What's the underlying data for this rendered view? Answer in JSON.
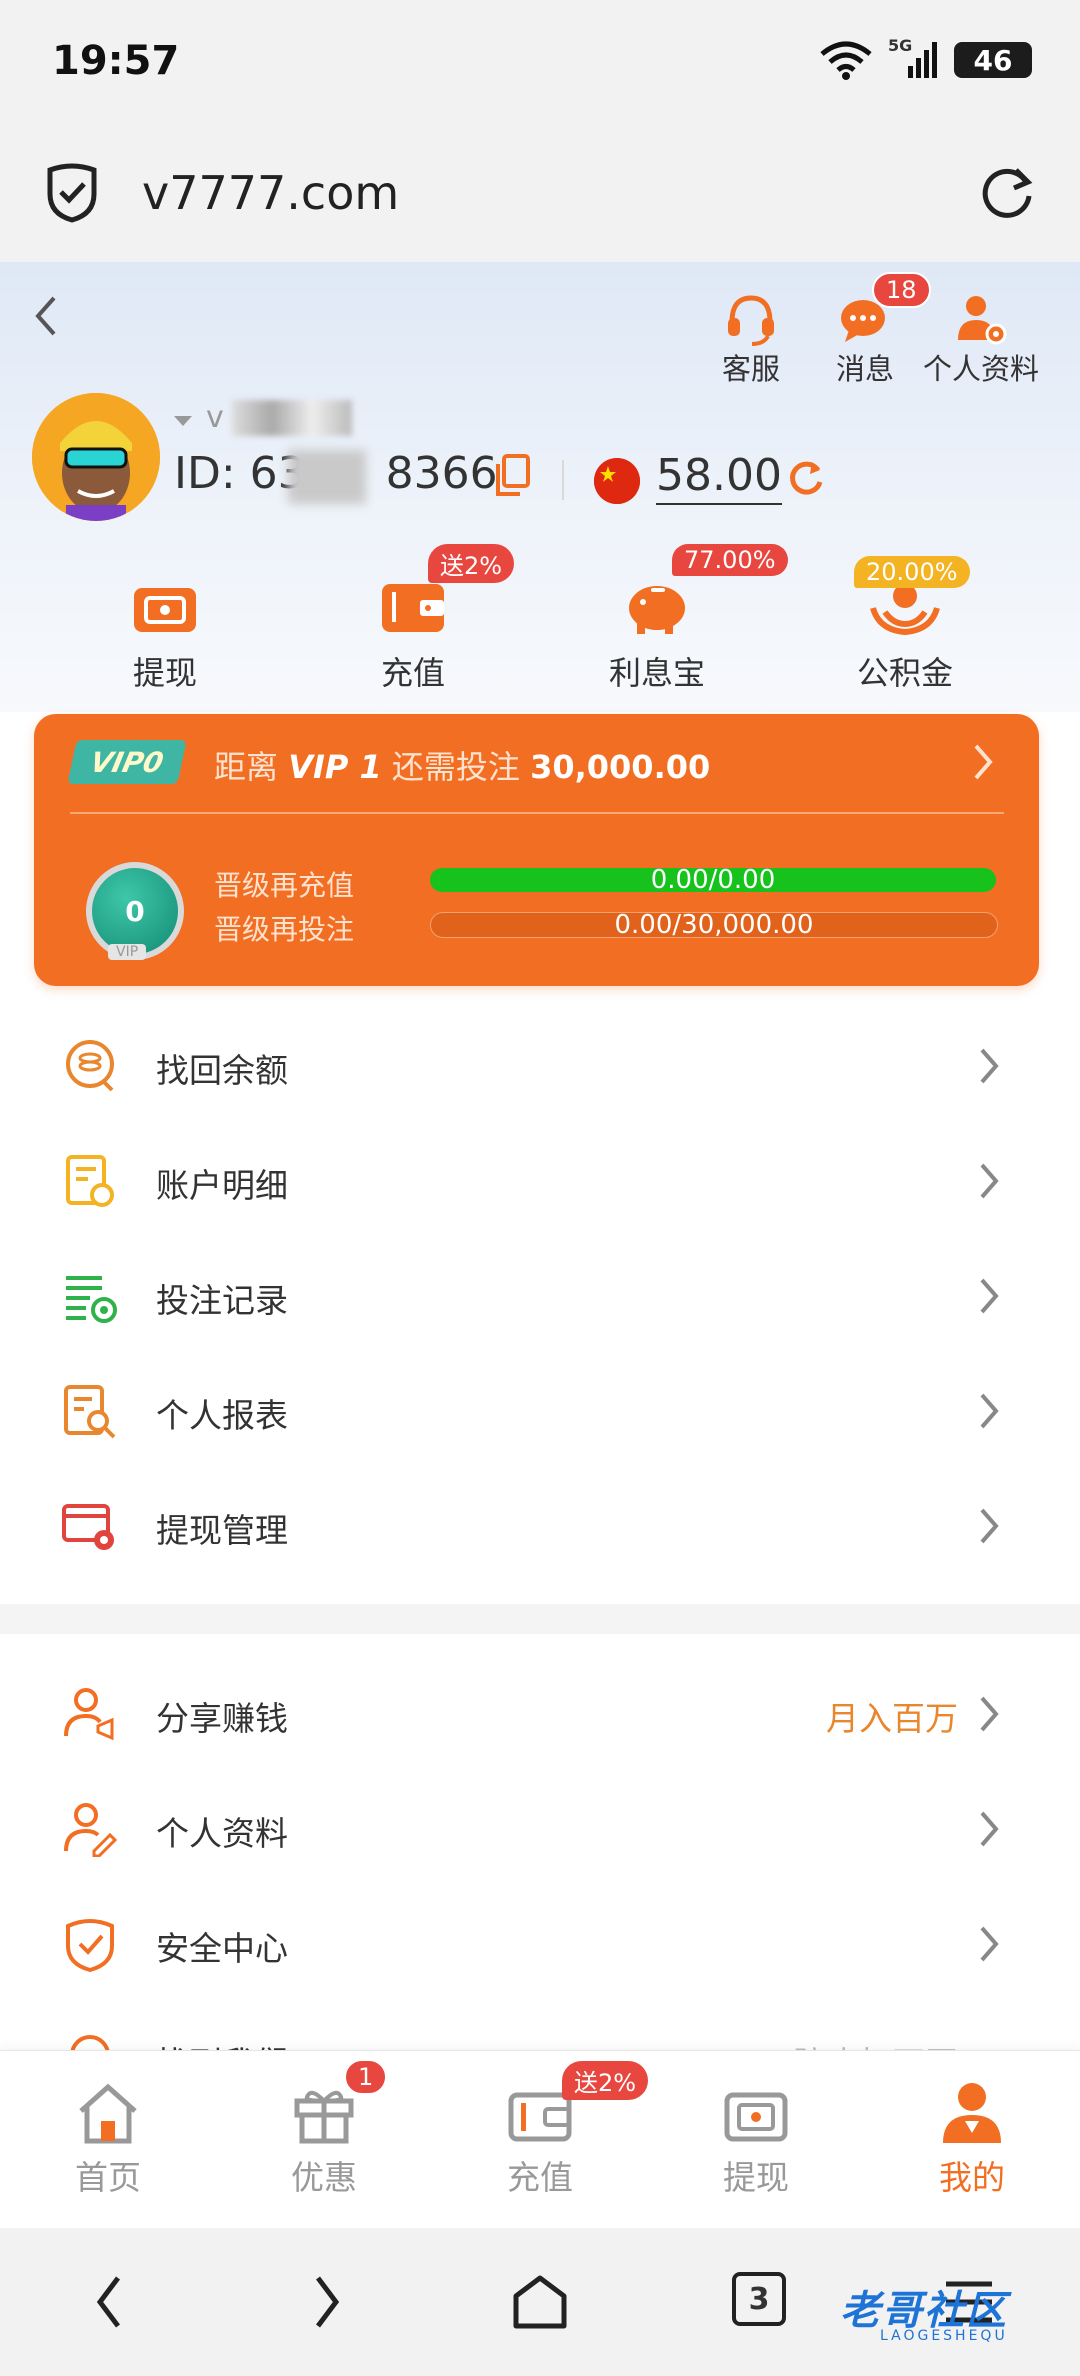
{
  "status": {
    "time": "19:57",
    "network": "5G",
    "battery": "46"
  },
  "browser": {
    "url": "v7777.com",
    "tab_count": "3"
  },
  "header": {
    "actions": [
      {
        "label": "客服",
        "icon": "headset-icon"
      },
      {
        "label": "消息",
        "icon": "chat-icon",
        "badge": "18"
      },
      {
        "label": "个人资料",
        "icon": "user-gear-icon"
      }
    ],
    "username": "v",
    "user_id": "ID: 63",
    "user_id_tail": "8366",
    "balance": "58.00"
  },
  "quick_actions": [
    {
      "label": "提现",
      "icon": "withdraw-ticket-icon",
      "badge": ""
    },
    {
      "label": "充值",
      "icon": "wallet-icon",
      "badge": "送2%"
    },
    {
      "label": "利息宝",
      "icon": "piggy-bank-icon",
      "badge": "77.00%"
    },
    {
      "label": "公积金",
      "icon": "hands-coin-icon",
      "badge": "20.00%"
    }
  ],
  "vip": {
    "tag": "VIP0",
    "prefix": "距离",
    "next_level": "VIP 1",
    "mid": "还需投注",
    "amount": "30,000.00",
    "medal_level": "0",
    "medal_caption": "VIP",
    "rows": [
      {
        "label": "晋级再充值",
        "value": "0.00/0.00",
        "progress": 1.0
      },
      {
        "label": "晋级再投注",
        "value": "0.00/30,000.00",
        "progress": 0.0
      }
    ]
  },
  "menu_primary": [
    {
      "label": "找回余额",
      "icon": "coin-search-icon",
      "color": "#e8872e"
    },
    {
      "label": "账户明细",
      "icon": "account-detail-icon",
      "color": "#f3b322"
    },
    {
      "label": "投注记录",
      "icon": "bet-record-icon",
      "color": "#2fb24a"
    },
    {
      "label": "个人报表",
      "icon": "report-search-icon",
      "color": "#e8872e"
    },
    {
      "label": "提现管理",
      "icon": "card-gear-icon",
      "color": "#e0443c"
    }
  ],
  "menu_secondary": [
    {
      "label": "分享赚钱",
      "icon": "share-user-icon",
      "extra": "月入百万"
    },
    {
      "label": "个人资料",
      "icon": "user-edit-icon",
      "extra": ""
    },
    {
      "label": "安全中心",
      "icon": "shield-check-icon",
      "extra": ""
    },
    {
      "label": "找到我们",
      "icon": "location-icon",
      "extra": "防止打不开"
    }
  ],
  "tabbar": [
    {
      "label": "首页",
      "icon": "home-icon",
      "badge": ""
    },
    {
      "label": "优惠",
      "icon": "gift-icon",
      "badge": "1"
    },
    {
      "label": "充值",
      "icon": "wallet-icon",
      "badge": "送2%"
    },
    {
      "label": "提现",
      "icon": "withdraw-ticket-icon",
      "badge": ""
    },
    {
      "label": "我的",
      "icon": "person-icon",
      "badge": "",
      "active": true
    }
  ],
  "watermark": {
    "text": "老哥社区",
    "sub": "LAOGESHEQU"
  }
}
